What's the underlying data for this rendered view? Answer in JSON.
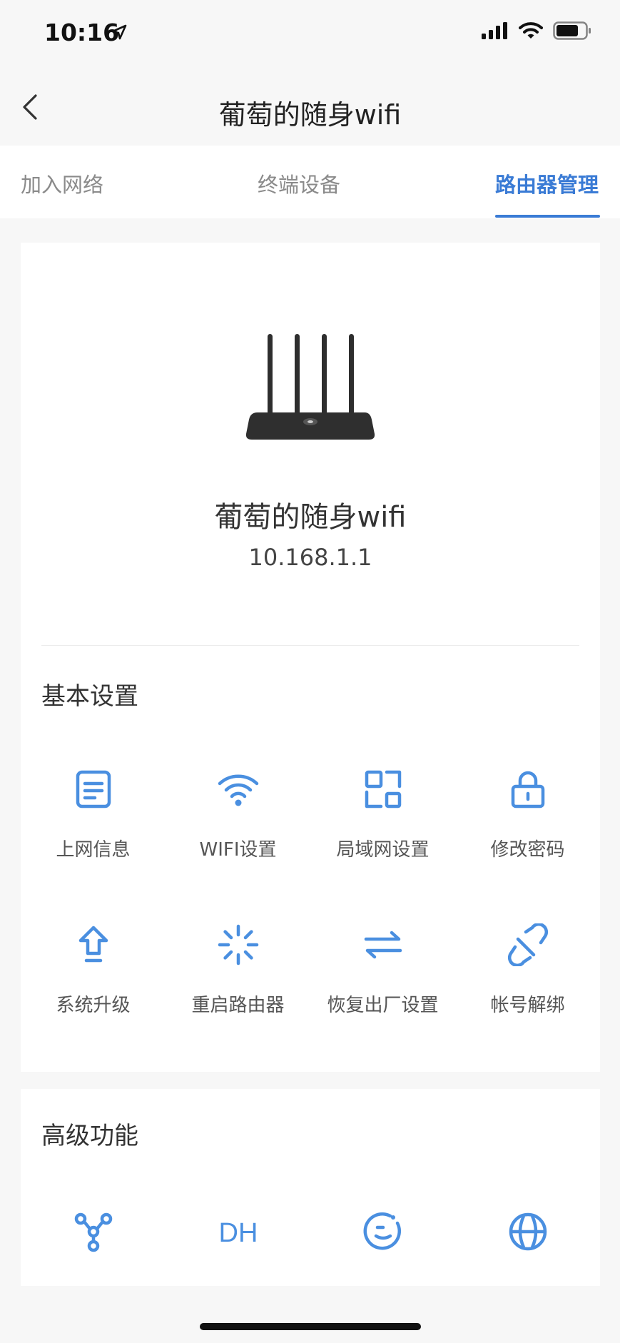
{
  "status": {
    "time": "10:16"
  },
  "nav": {
    "title": "葡萄的随身wifi"
  },
  "tabs": [
    {
      "label": "加入网络",
      "active": false
    },
    {
      "label": "终端设备",
      "active": false
    },
    {
      "label": "路由器管理",
      "active": true
    }
  ],
  "router": {
    "name": "葡萄的随身wifi",
    "ip": "10.168.1.1"
  },
  "basic": {
    "title": "基本设置",
    "items": [
      {
        "label": "上网信息",
        "icon": "document-icon"
      },
      {
        "label": "WIFI设置",
        "icon": "wifi-icon"
      },
      {
        "label": "局域网设置",
        "icon": "lan-layout-icon"
      },
      {
        "label": "修改密码",
        "icon": "lock-icon"
      },
      {
        "label": "系统升级",
        "icon": "upload-arrow-icon"
      },
      {
        "label": "重启路由器",
        "icon": "loading-spinner-icon"
      },
      {
        "label": "恢复出厂设置",
        "icon": "swap-arrows-icon"
      },
      {
        "label": "帐号解绑",
        "icon": "unlink-icon"
      }
    ]
  },
  "advanced": {
    "title": "高级功能",
    "items": [
      {
        "label": "",
        "icon": "network-nodes-icon"
      },
      {
        "label": "",
        "icon": "dhcp-icon",
        "glyph": "DH"
      },
      {
        "label": "",
        "icon": "smile-icon"
      },
      {
        "label": "",
        "icon": "globe-icon"
      }
    ]
  },
  "colors": {
    "accent": "#3a7bd5",
    "icon": "#4a8fe0",
    "background": "#f7f7f7"
  }
}
